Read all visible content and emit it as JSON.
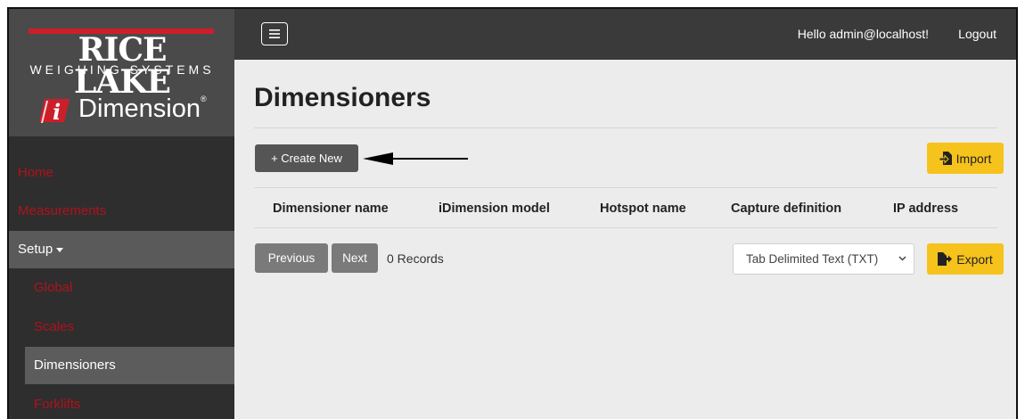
{
  "sidebar": {
    "brand": {
      "name": "RICE LAKE",
      "tagline": "WEIGHING SYSTEMS",
      "product_letter": "i",
      "product": "Dimension",
      "registered": "®"
    },
    "items": [
      {
        "label": "Home"
      },
      {
        "label": "Measurements"
      },
      {
        "label": "Setup"
      },
      {
        "label": "Global"
      },
      {
        "label": "Scales"
      },
      {
        "label": "Dimensioners"
      },
      {
        "label": "Forklifts"
      }
    ]
  },
  "topbar": {
    "greeting": "Hello admin@localhost!",
    "logout": "Logout"
  },
  "main": {
    "title": "Dimensioners",
    "create_button": "+ Create New",
    "import_button": "Import",
    "columns": [
      "Dimensioner name",
      "iDimension model",
      "Hotspot name",
      "Capture definition",
      "IP address"
    ],
    "pagination": {
      "previous": "Previous",
      "next": "Next",
      "records": "0 Records"
    },
    "export_format": "Tab Delimited Text (TXT)",
    "export_button": "Export"
  },
  "colors": {
    "accent_yellow": "#f6c21c",
    "brand_red": "#cc1f2a",
    "nav_red": "#b0121c",
    "sidebar_bg": "#2e2e2e",
    "topbar_bg": "#3a3a3a",
    "content_bg": "#ececec"
  },
  "icons": {
    "menu": "hamburger-icon",
    "import": "file-import-icon",
    "export": "file-export-icon",
    "select": "chevron-down-icon",
    "setup": "caret-down-icon",
    "annotation": "arrow-left-icon"
  }
}
